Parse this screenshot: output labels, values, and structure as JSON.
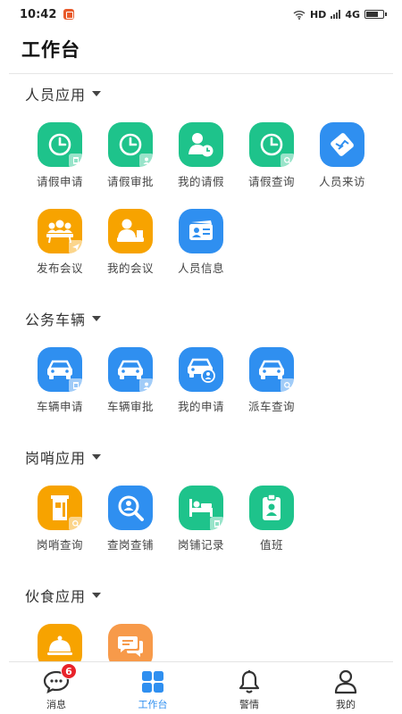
{
  "status_bar": {
    "time": "10:42",
    "network": "HD",
    "carrier": "4G"
  },
  "page": {
    "title": "工作台"
  },
  "sections": [
    {
      "title": "人员应用",
      "items": [
        {
          "label": "请假申请",
          "icon": "clock-doc-icon",
          "color": "green"
        },
        {
          "label": "请假审批",
          "icon": "clock-person-icon",
          "color": "green"
        },
        {
          "label": "我的请假",
          "icon": "person-clock-icon",
          "color": "green"
        },
        {
          "label": "请假查询",
          "icon": "clock-search-icon",
          "color": "green"
        },
        {
          "label": "人员来访",
          "icon": "handshake-icon",
          "color": "blue"
        },
        {
          "label": "发布会议",
          "icon": "meeting-send-icon",
          "color": "orange"
        },
        {
          "label": "我的会议",
          "icon": "meeting-person-icon",
          "color": "orange"
        },
        {
          "label": "人员信息",
          "icon": "id-card-icon",
          "color": "blue"
        }
      ]
    },
    {
      "title": "公务车辆",
      "items": [
        {
          "label": "车辆申请",
          "icon": "car-doc-icon",
          "color": "blue"
        },
        {
          "label": "车辆审批",
          "icon": "car-person-icon",
          "color": "blue"
        },
        {
          "label": "我的申请",
          "icon": "car-user-icon",
          "color": "blue"
        },
        {
          "label": "派车查询",
          "icon": "car-search-icon",
          "color": "blue"
        }
      ]
    },
    {
      "title": "岗哨应用",
      "items": [
        {
          "label": "岗哨查询",
          "icon": "sentry-search-icon",
          "color": "orange"
        },
        {
          "label": "查岗查铺",
          "icon": "magnifier-person-icon",
          "color": "blue"
        },
        {
          "label": "岗铺记录",
          "icon": "bed-record-icon",
          "color": "green"
        },
        {
          "label": "值班",
          "icon": "duty-badge-icon",
          "color": "green"
        }
      ]
    },
    {
      "title": "伙食应用",
      "items": [
        {
          "label": "",
          "icon": "food-cloche-icon",
          "color": "orange"
        },
        {
          "label": "",
          "icon": "chat-bubbles-icon",
          "color": "salmon"
        }
      ]
    }
  ],
  "tab_bar": {
    "tabs": [
      {
        "label": "消息",
        "icon": "message-icon",
        "badge": "6"
      },
      {
        "label": "工作台",
        "icon": "workbench-grid-icon"
      },
      {
        "label": "警情",
        "icon": "bell-icon"
      },
      {
        "label": "我的",
        "icon": "user-icon"
      }
    ]
  },
  "colors": {
    "green": "#1ec38b",
    "blue": "#2f8ff0",
    "orange": "#f7a300",
    "salmon": "#f79a4a",
    "active_tab": "#2f8ff0",
    "badge": "#e8232a"
  }
}
